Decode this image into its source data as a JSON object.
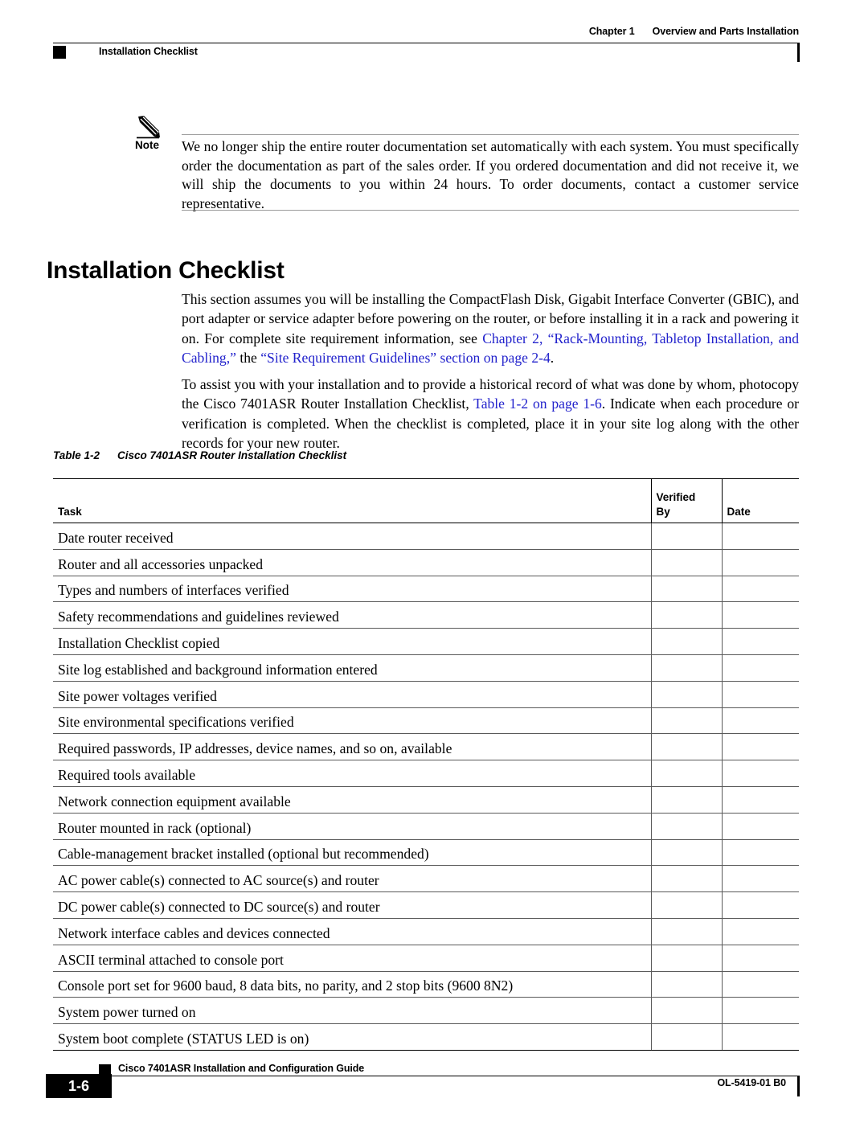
{
  "header": {
    "chapter_label": "Chapter 1",
    "chapter_title": "Overview and Parts Installation",
    "section_title": "Installation Checklist"
  },
  "note": {
    "label": "Note",
    "icon": "pencil-icon",
    "text": "We no longer ship the entire router documentation set automatically with each system. You must specifically order the documentation as part of the sales order. If you ordered documentation and did not receive it, we will ship the documents to you within 24 hours. To order documents, contact a customer service representative."
  },
  "section": {
    "heading": "Installation Checklist"
  },
  "paragraphs": {
    "p1": {
      "part1": "This section assumes you will be installing the CompactFlash Disk, Gigabit Interface Converter (GBIC), and port adapter or service adapter before powering on the router, or before installing it in a rack and powering it on. For complete site requirement information, see ",
      "link1": "Chapter 2, “Rack-Mounting, Tabletop Installation, and Cabling,”",
      "part2": " the ",
      "link2": "“Site Requirement Guidelines” section on page 2-4",
      "part3": "."
    },
    "p2": {
      "part1": "To assist you with your installation and to provide a historical record of what was done by whom, photocopy the Cisco 7401ASR Router Installation Checklist, ",
      "link1": "Table 1-2 on page 1-6",
      "part2": ". Indicate when each procedure or verification is completed. When the checklist is completed, place it in your site log along with the other records for your new router."
    }
  },
  "table": {
    "caption_number": "Table 1-2",
    "caption_title": "Cisco 7401ASR Router Installation Checklist",
    "columns": {
      "task": "Task",
      "verified_by_line1": "Verified",
      "verified_by_line2": "By",
      "date": "Date"
    },
    "rows": [
      {
        "task": "Date router received",
        "verified_by": "",
        "date": ""
      },
      {
        "task": "Router and all accessories unpacked",
        "verified_by": "",
        "date": ""
      },
      {
        "task": "Types and numbers of interfaces verified",
        "verified_by": "",
        "date": ""
      },
      {
        "task": "Safety recommendations and guidelines reviewed",
        "verified_by": "",
        "date": ""
      },
      {
        "task": "Installation Checklist copied",
        "verified_by": "",
        "date": ""
      },
      {
        "task": "Site log established and background information entered",
        "verified_by": "",
        "date": ""
      },
      {
        "task": "Site power voltages verified",
        "verified_by": "",
        "date": ""
      },
      {
        "task": "Site environmental specifications verified",
        "verified_by": "",
        "date": ""
      },
      {
        "task": "Required passwords, IP addresses, device names, and so on, available",
        "verified_by": "",
        "date": ""
      },
      {
        "task": "Required tools available",
        "verified_by": "",
        "date": ""
      },
      {
        "task": "Network connection equipment available",
        "verified_by": "",
        "date": ""
      },
      {
        "task": "Router mounted in rack (optional)",
        "verified_by": "",
        "date": ""
      },
      {
        "task": "Cable-management bracket installed (optional but recommended)",
        "verified_by": "",
        "date": ""
      },
      {
        "task": "AC power cable(s) connected to AC source(s) and router",
        "verified_by": "",
        "date": ""
      },
      {
        "task": "DC power cable(s) connected to DC source(s) and router",
        "verified_by": "",
        "date": ""
      },
      {
        "task": "Network interface cables and devices connected",
        "verified_by": "",
        "date": ""
      },
      {
        "task": "ASCII terminal attached to console port",
        "verified_by": "",
        "date": ""
      },
      {
        "task": "Console port set for 9600 baud, 8 data bits, no parity, and 2 stop bits (9600 8N2)",
        "verified_by": "",
        "date": ""
      },
      {
        "task": "System power turned on",
        "verified_by": "",
        "date": ""
      },
      {
        "task": "System boot complete (STATUS LED is on)",
        "verified_by": "",
        "date": ""
      }
    ]
  },
  "footer": {
    "page_number": "1-6",
    "guide_title": "Cisco 7401ASR Installation and Configuration Guide",
    "doc_id": "OL-5419-01 B0"
  },
  "colors": {
    "link": "#2222cc",
    "text": "#000000",
    "rule": "#000000",
    "page_background": "#ffffff"
  }
}
